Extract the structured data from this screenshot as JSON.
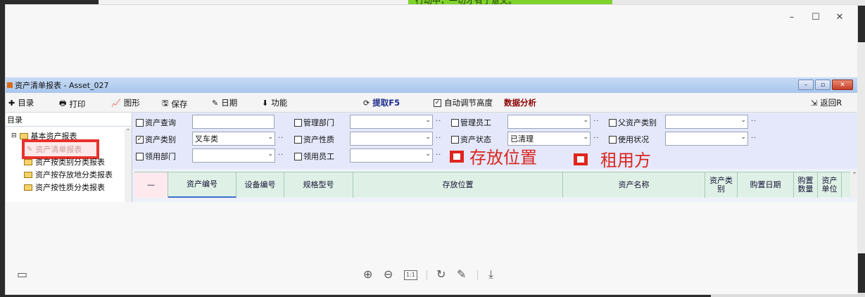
{
  "background": {
    "top_text": "行动中，一切才有了意义。"
  },
  "viewer": {
    "controls": [
      "–",
      "☐",
      "✕"
    ],
    "bottom_tools": {
      "fit_label": "1:1"
    }
  },
  "app": {
    "title": "资产清单报表 - Asset_027",
    "title_buttons": [
      "–",
      "▫",
      "✕"
    ],
    "toolbar": {
      "catalog": "目录",
      "print": "打印",
      "chart": "图形",
      "save": "保存",
      "date": "日期",
      "function": "功能",
      "extract": "提取F5",
      "auto_height": "自动调节高度",
      "analysis": "数据分析",
      "back": "返回R"
    },
    "tree": {
      "header": "目录",
      "items": [
        "基本资产报表",
        "资产清单报表",
        "资产按类别分类报表",
        "资产按存放地分类报表",
        "资产按性质分类报表"
      ]
    },
    "filters": {
      "row1": {
        "asset_query": "资产查询",
        "asset_query_value": "",
        "dept": "管理部门",
        "staff": "管理员工",
        "parent_category": "父资产类别"
      },
      "row2": {
        "category": "资产类别",
        "category_value": "叉车类",
        "nature": "资产性质",
        "status": "资产状态",
        "status_value": "已清理",
        "usage": "使用状况"
      },
      "row3": {
        "use_dept": "领用部门",
        "use_staff": "领用员工"
      },
      "annotations": {
        "location": "存放位置",
        "lessor": "租用方"
      }
    },
    "grid": {
      "columns": [
        "—",
        "资产编号",
        "设备编号",
        "规格型号",
        "存放位置",
        "资产名称",
        "资产类别",
        "购置日期",
        "购置数量",
        "资产单位"
      ]
    }
  }
}
